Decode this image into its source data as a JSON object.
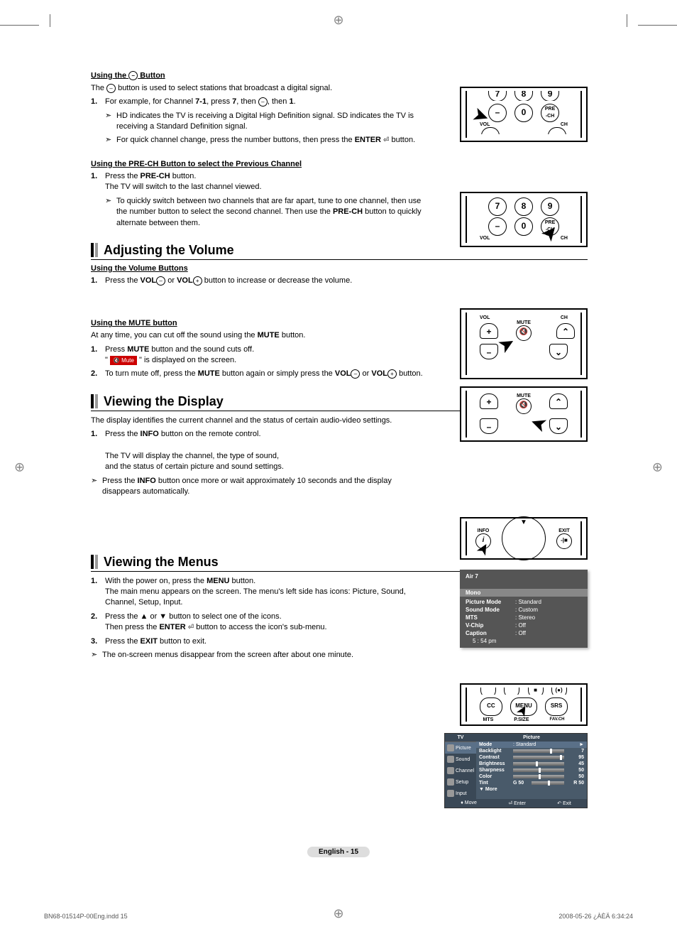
{
  "sec1": {
    "heading": "Using the        Button",
    "p1_a": "The ",
    "p1_b": " button is used to select stations that broadcast a digital signal.",
    "li1_a": "For example, for Channel ",
    "li1_bold1": "7-1",
    "li1_b": ", press ",
    "li1_bold2": "7",
    "li1_c": ", then ",
    "li1_d": ", then ",
    "li1_bold3": "1",
    "li1_e": ".",
    "note1": "HD indicates the TV is receiving a Digital High Definition signal. SD indicates the TV is receiving a Standard Definition signal.",
    "note2_a": "For quick channel change, press the number buttons, then press the ",
    "note2_b": "ENTER",
    "note2_c": " button."
  },
  "sec2": {
    "heading": "Using the PRE-CH Button to select the Previous Channel",
    "li1_a": "Press the ",
    "li1_b": "PRE-CH",
    "li1_c": " button.",
    "li1_d": "The TV will switch to the last channel viewed.",
    "note1_a": "To quickly switch between two channels that are far apart, tune to one channel, then use the number button to select the second channel. Then use the ",
    "note1_b": "PRE-CH",
    "note1_c": " button to quickly alternate between them."
  },
  "sec3": {
    "title": "Adjusting the Volume",
    "sub1": "Using the Volume Buttons",
    "li1_a": "Press the ",
    "li1_b": "VOL",
    "li1_c": " or ",
    "li1_d": "VOL",
    "li1_e": " button to increase or decrease the volume.",
    "sub2": "Using the MUTE button",
    "p2_a": "At any time, you can cut off the sound using the ",
    "p2_b": "MUTE",
    "p2_c": " button.",
    "li2_a": "Press ",
    "li2_b": "MUTE",
    "li2_c": " button and the sound cuts off.",
    "li2_d1": "\" ",
    "li2_badge": "Mute",
    "li2_d2": " \" is displayed on the screen.",
    "li3_a": "To turn mute off, press the ",
    "li3_b": "MUTE",
    "li3_c": " button again or simply press the ",
    "li3_d": "VOL",
    "li3_e": " or ",
    "li3_f": "VOL",
    "li3_g": " button."
  },
  "sec4": {
    "title": "Viewing the Display",
    "p1": "The display identifies the current channel and the status of certain audio-video settings.",
    "li1_a": "Press the ",
    "li1_b": "INFO",
    "li1_c": " button on the remote control.",
    "li1_d": "The TV will display the channel, the type of sound,",
    "li1_e": "and the status of certain picture and sound settings.",
    "note1_a": "Press the ",
    "note1_b": "INFO",
    "note1_c": " button once more or wait approximately 10 seconds and the display disappears automatically."
  },
  "sec5": {
    "title": "Viewing the Menus",
    "li1_a": "With the power on, press the ",
    "li1_b": "MENU",
    "li1_c": " button.",
    "li1_d": "The main menu appears on the screen. The menu's left side has icons: Picture, Sound, Channel, Setup, Input.",
    "li2_a": "Press the ▲ or ▼ button to select one of the icons.",
    "li2_b": "Then press the ",
    "li2_c": "ENTER",
    "li2_d": " button to access the icon's sub-menu.",
    "li3_a": "Press the ",
    "li3_b": "EXIT",
    "li3_c": " button to exit.",
    "note1": "The on-screen menus disappear from the screen after about one minute."
  },
  "remote": {
    "nums": [
      "7",
      "8",
      "9"
    ],
    "zero": "0",
    "prech": "PRE\n-CH",
    "vol": "VOL",
    "ch": "CH",
    "mute": "MUTE",
    "info": "INFO",
    "exit": "EXIT",
    "cc": "CC",
    "menu": "MENU",
    "srs": "SRS",
    "mts": "MTS",
    "psize": "P.SIZE",
    "favch": "FAV.CH"
  },
  "osd": {
    "ch": "Air 7",
    "mono": "Mono",
    "rows": [
      {
        "k": "Picture Mode",
        "v": ": Standard"
      },
      {
        "k": "Sound Mode",
        "v": ": Custom"
      },
      {
        "k": "MTS",
        "v": ": Stereo"
      },
      {
        "k": "V-Chip",
        "v": ": Off"
      },
      {
        "k": "Caption",
        "v": ": Off"
      }
    ],
    "time": "5 : 54 pm"
  },
  "menu": {
    "tv": "TV",
    "title": "Picture",
    "side": [
      "Picture",
      "Sound",
      "Channel",
      "Setup",
      "Input"
    ],
    "rows": [
      {
        "k": "Mode",
        "type": "val",
        "v": ": Standard",
        "arrow": "►"
      },
      {
        "k": "Backlight",
        "type": "slider",
        "pos": 72,
        "v": "7"
      },
      {
        "k": "Contrast",
        "type": "slider",
        "pos": 92,
        "v": "95"
      },
      {
        "k": "Brightness",
        "type": "slider",
        "pos": 45,
        "v": "45"
      },
      {
        "k": "Sharpness",
        "type": "slider",
        "pos": 50,
        "v": "50"
      },
      {
        "k": "Color",
        "type": "slider",
        "pos": 50,
        "v": "50"
      },
      {
        "k": "Tint",
        "type": "tint",
        "left": "G 50",
        "pos": 50,
        "v": "R 50"
      },
      {
        "k": "▼ More",
        "type": "more"
      }
    ],
    "foot": {
      "move": "Move",
      "enter": "Enter",
      "exit": "Exit"
    }
  },
  "footer": {
    "page": "English - 15",
    "docl": "BN68-01514P-00Eng.indd   15",
    "docr": "2008-05-26   ¿ÀÈÄ 6:34:24"
  }
}
